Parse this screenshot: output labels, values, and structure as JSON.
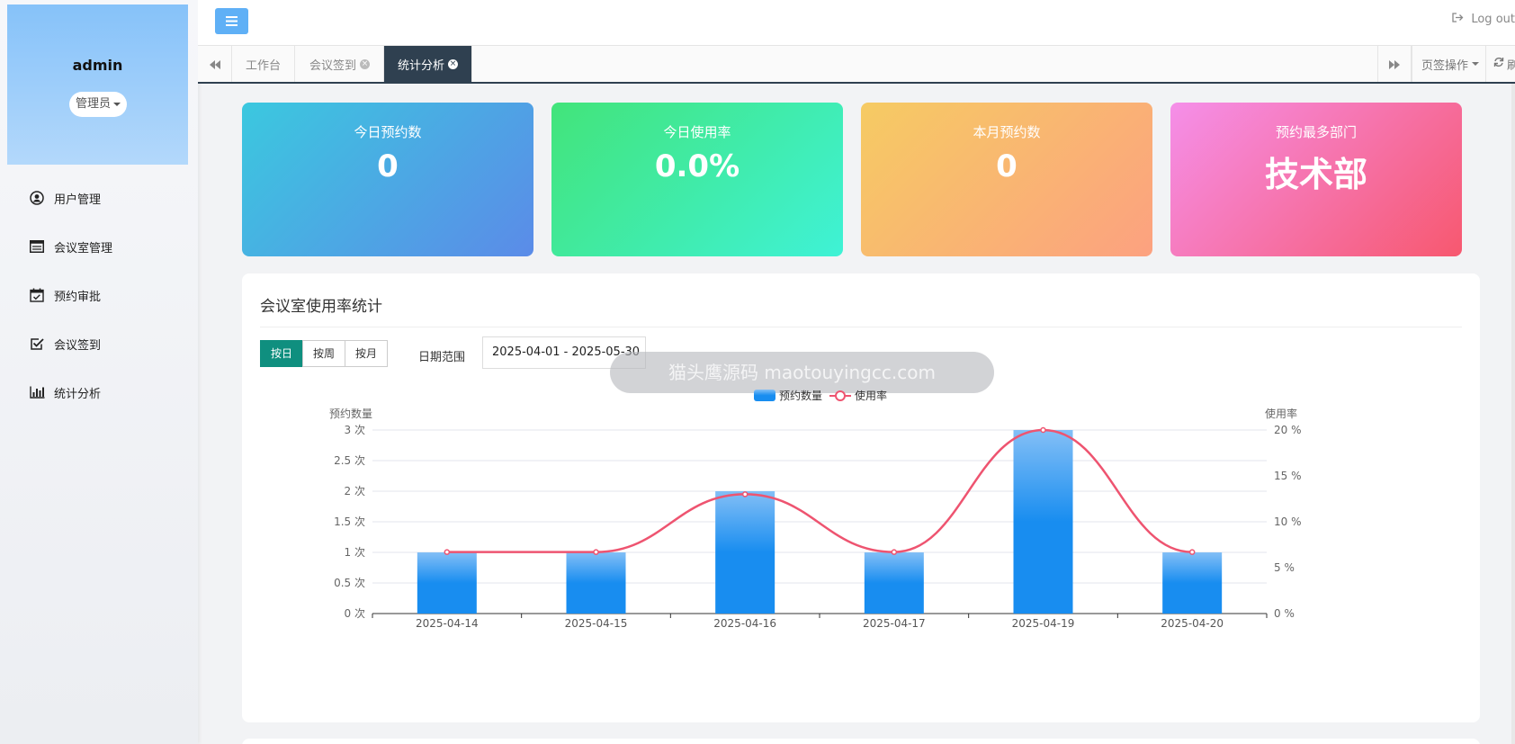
{
  "sidebar": {
    "user_name": "admin",
    "role": "管理员",
    "items": [
      {
        "label": "用户管理",
        "icon": "user-circle-icon"
      },
      {
        "label": "会议室管理",
        "icon": "room-list-icon"
      },
      {
        "label": "预约审批",
        "icon": "calendar-check-icon"
      },
      {
        "label": "会议签到",
        "icon": "checkbox-icon"
      },
      {
        "label": "统计分析",
        "icon": "bar-chart-icon"
      }
    ]
  },
  "header": {
    "menu_icon": "hamburger-icon",
    "logout_label": "Log out"
  },
  "tabs": {
    "items": [
      {
        "label": "工作台",
        "closable": false
      },
      {
        "label": "会议签到",
        "closable": true
      },
      {
        "label": "统计分析",
        "closable": true,
        "active": true
      }
    ],
    "page_ops_label": "页签操作",
    "refresh_label": "刷"
  },
  "stats": [
    {
      "label": "今日预约数",
      "value": "0",
      "gradient": [
        "#3bc8df",
        "#5b8be8"
      ]
    },
    {
      "label": "今日使用率",
      "value": "0.0%",
      "gradient": [
        "#42e47a",
        "#3ff2d6"
      ]
    },
    {
      "label": "本月预约数",
      "value": "0",
      "gradient": [
        "#f6cb63",
        "#fca180"
      ]
    },
    {
      "label": "预约最多部门",
      "value": "技术部",
      "gradient": [
        "#f58fe9",
        "#f7586f"
      ]
    }
  ],
  "panel": {
    "title": "会议室使用率统计",
    "granularity": [
      "按日",
      "按周",
      "按月"
    ],
    "selected_granularity": "按日",
    "date_label": "日期范围",
    "date_value": "2025-04-01 - 2025-05-30",
    "watermark": "猫头鹰源码 maotouyingcc.com"
  },
  "chart_data": {
    "type": "bar",
    "categories": [
      "2025-04-14",
      "2025-04-15",
      "2025-04-16",
      "2025-04-17",
      "2025-04-19",
      "2025-04-20"
    ],
    "series": [
      {
        "name": "预约数量",
        "type": "bar",
        "axis": "left",
        "values": [
          1,
          1,
          2,
          1,
          3,
          1
        ],
        "color": "#1a8be8"
      },
      {
        "name": "使用率",
        "type": "line",
        "axis": "right",
        "smooth": true,
        "values": [
          6.7,
          6.7,
          13,
          6.7,
          20,
          6.7
        ],
        "color": "#ee5470"
      }
    ],
    "ylabel_left": "预约数量",
    "ylabel_right": "使用率",
    "ylim_left": [
      0,
      3
    ],
    "ylim_right": [
      0,
      20
    ],
    "yticks_left": [
      "0 次",
      "0.5 次",
      "1 次",
      "1.5 次",
      "2 次",
      "2.5 次",
      "3 次"
    ],
    "yticks_right": [
      "0 %",
      "5 %",
      "10 %",
      "15 %",
      "20 %"
    ],
    "legend": "top-center",
    "grid": true
  }
}
